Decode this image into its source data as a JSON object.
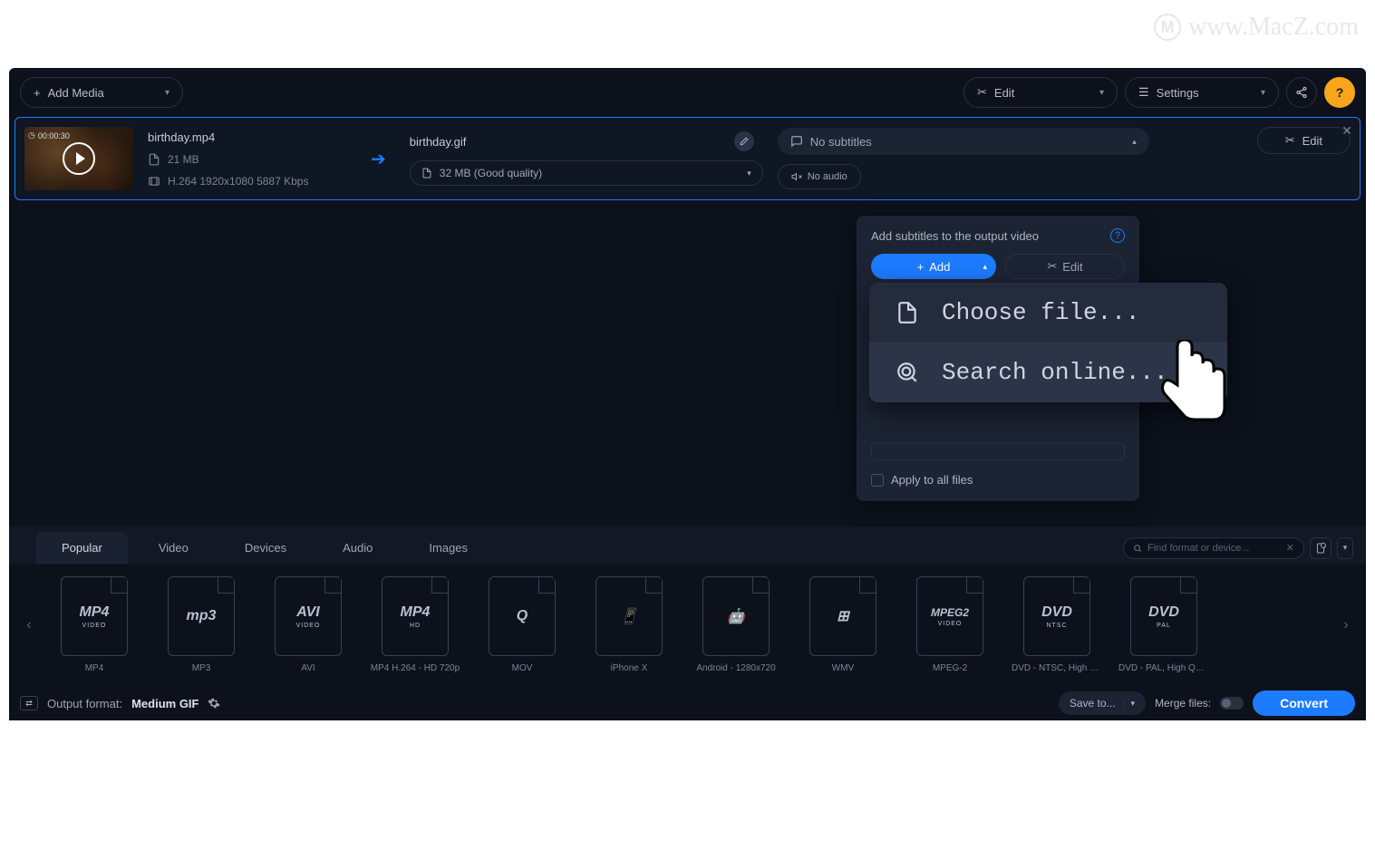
{
  "watermark": "www.MacZ.com",
  "topbar": {
    "add_media": "Add Media",
    "edit": "Edit",
    "settings": "Settings"
  },
  "media": {
    "duration": "00:00:30",
    "source_name": "birthday.mp4",
    "source_size": "21 MB",
    "source_codec": "H.264 1920x1080 5887 Kbps",
    "target_name": "birthday.gif",
    "target_size": "32 MB (Good quality)",
    "subtitle_field": "No subtitles",
    "audio_field": "No audio",
    "edit_btn": "Edit"
  },
  "popover": {
    "title": "Add subtitles to the output video",
    "add": "Add",
    "edit": "Edit",
    "apply_all": "Apply to all files"
  },
  "dropdown": {
    "choose_file": "Choose file...",
    "search_online": "Search online..."
  },
  "tabs": {
    "popular": "Popular",
    "video": "Video",
    "devices": "Devices",
    "audio": "Audio",
    "images": "Images"
  },
  "find": {
    "placeholder": "Find format or device..."
  },
  "formats": [
    {
      "icon_main": "MP4",
      "icon_sub": "VIDEO",
      "label": "MP4"
    },
    {
      "icon_main": "mp3",
      "icon_sub": "",
      "label": "MP3"
    },
    {
      "icon_main": "AVI",
      "icon_sub": "VIDEO",
      "label": "AVI"
    },
    {
      "icon_main": "MP4",
      "icon_sub": "HD",
      "label": "MP4 H.264 - HD 720p"
    },
    {
      "icon_main": "Q",
      "icon_sub": "",
      "label": "MOV"
    },
    {
      "icon_main": "📱",
      "icon_sub": "",
      "label": "iPhone X"
    },
    {
      "icon_main": "🤖",
      "icon_sub": "",
      "label": "Android - 1280x720"
    },
    {
      "icon_main": "⊞",
      "icon_sub": "",
      "label": "WMV"
    },
    {
      "icon_main": "MPEG2",
      "icon_sub": "VIDEO",
      "label": "MPEG-2"
    },
    {
      "icon_main": "DVD",
      "icon_sub": "NTSC",
      "label": "DVD - NTSC, High Qu..."
    },
    {
      "icon_main": "DVD",
      "icon_sub": "PAL",
      "label": "DVD - PAL, High Qual..."
    }
  ],
  "footer": {
    "out_label": "Output format:",
    "out_value": "Medium GIF",
    "save_to": "Save to...",
    "merge": "Merge files:",
    "convert": "Convert"
  }
}
